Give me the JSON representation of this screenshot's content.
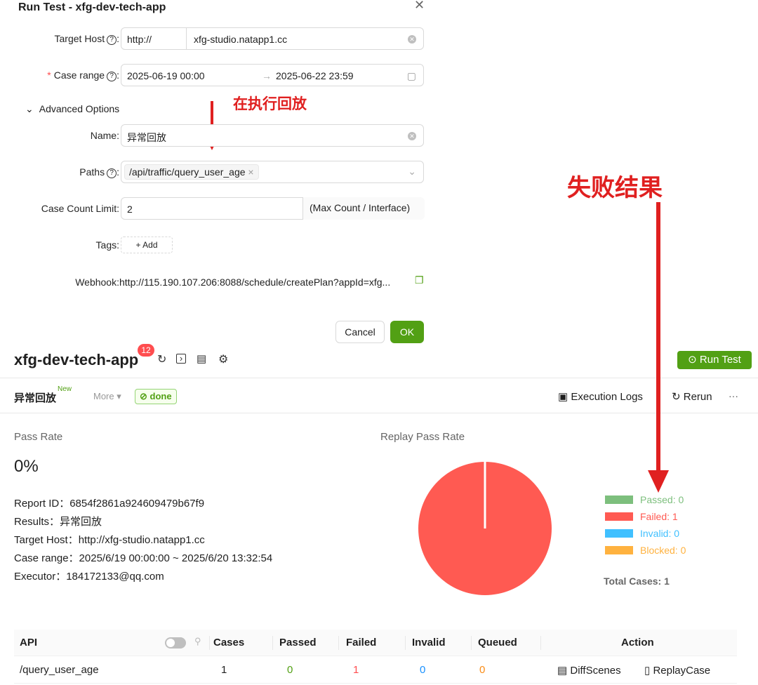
{
  "modal": {
    "title": "Run Test - xfg-dev-tech-app",
    "close_icon": "close-icon",
    "target_host": {
      "label": "Target Host",
      "protocol": "http://",
      "value": "xfg-studio.natapp1.cc"
    },
    "case_range": {
      "label": "Case range",
      "start": "2025-06-19 00:00",
      "separator": "→",
      "end": "2025-06-22 23:59"
    },
    "advanced_options": "Advanced Options",
    "name": {
      "label": "Name",
      "value": "异常回放"
    },
    "paths": {
      "label": "Paths",
      "tag": "/api/traffic/query_user_age"
    },
    "case_count_limit": {
      "label": "Case Count Limit",
      "value": "2",
      "suffix": "(Max Count / Interface)"
    },
    "tags": {
      "label": "Tags",
      "add_label": "+ Add"
    },
    "webhook": {
      "label": "Webhook",
      "value": "http://115.190.107.206:8088/schedule/createPlan?appId=xfg..."
    },
    "cancel_label": "Cancel",
    "ok_label": "OK"
  },
  "annotations": {
    "executing_replay": "在执行回放",
    "failure_result": "失败结果",
    "color": "#e02020"
  },
  "app": {
    "title": "xfg-dev-tech-app",
    "badge": "12",
    "run_test_label": "Run Test",
    "colors": {
      "accent": "#52a014"
    }
  },
  "report_bar": {
    "name": "异常回放",
    "new_badge": "New",
    "more_label": "More ▾",
    "status": "done",
    "execution_logs_label": "Execution Logs",
    "rerun_label": "Rerun",
    "more_icon": "···"
  },
  "summary": {
    "pass_rate_label": "Pass Rate",
    "pass_rate_value": "0%",
    "report_id": "Report ID：6854f2861a924609479b67f9",
    "results": "Results：异常回放",
    "target_host": "Target Host：http://xfg-studio.natapp1.cc",
    "case_range": "Case range：2025/6/19 00:00:00 ~ 2025/6/20 13:32:54",
    "executor": "Executor：184172133@qq.com"
  },
  "chart_data": {
    "type": "pie",
    "title": "Replay Pass Rate",
    "slices": [
      {
        "label": "Passed: 0",
        "value": 0,
        "color": "#7dbf7d"
      },
      {
        "label": "Failed: 1",
        "value": 1,
        "color": "#ff5a52"
      },
      {
        "label": "Invalid: 0",
        "value": 0,
        "color": "#40c0ff"
      },
      {
        "label": "Blocked: 0",
        "value": 0,
        "color": "#ffb23f"
      }
    ],
    "total_label": "Total Cases: 1"
  },
  "table": {
    "headers": [
      "API",
      "Cases",
      "Passed",
      "Failed",
      "Invalid",
      "Queued",
      "Action"
    ],
    "row": {
      "api": "/query_user_age",
      "cases": "1",
      "passed": "0",
      "failed": "1",
      "invalid": "0",
      "queued": "0",
      "diff_label": "DiffScenes",
      "replay_label": "ReplayCase"
    }
  }
}
